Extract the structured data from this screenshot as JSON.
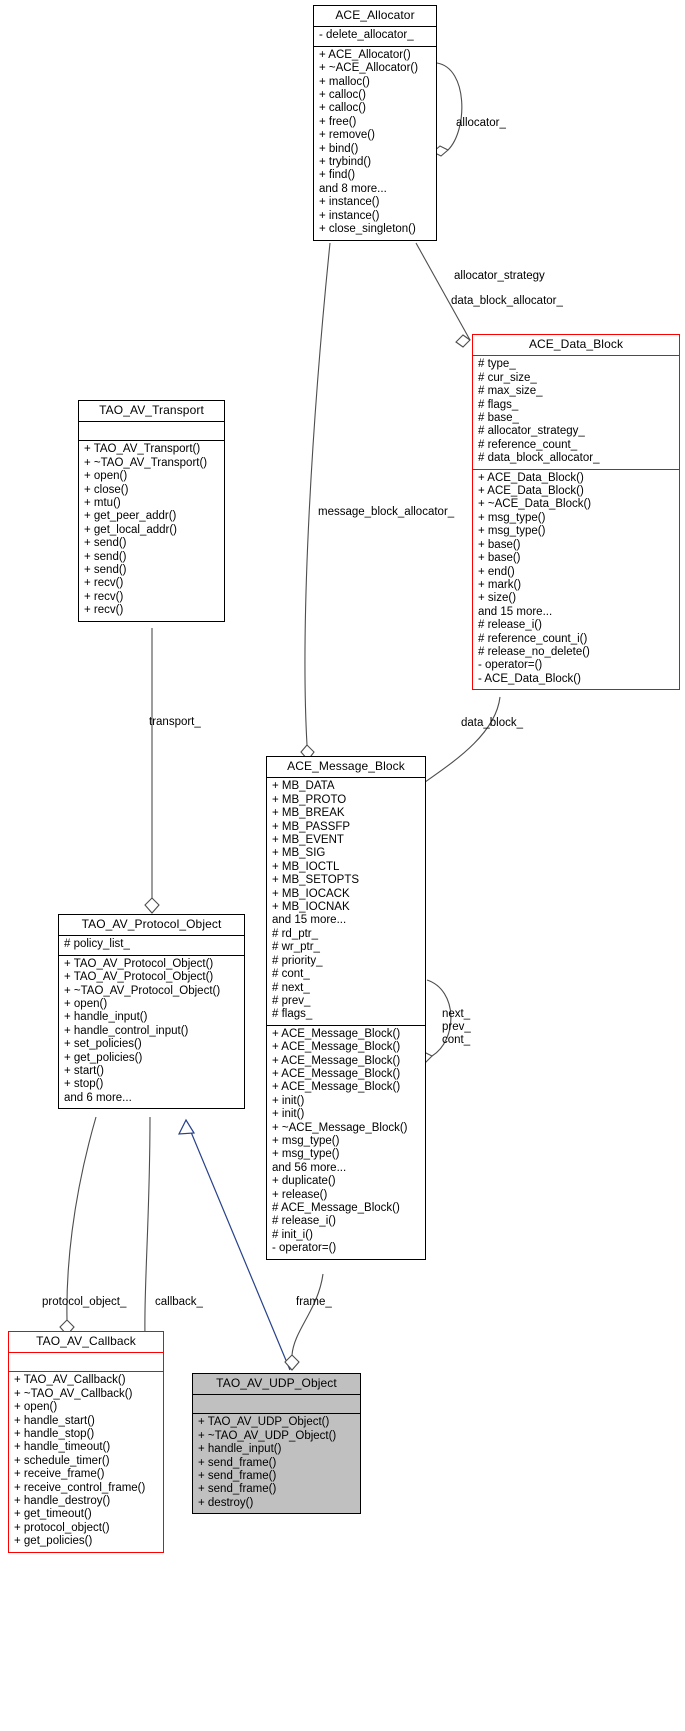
{
  "diagram": {
    "type": "uml-collaboration-diagram",
    "background": "#ffffff",
    "classes": [
      {
        "id": "ace_allocator",
        "title": "ACE_Allocator",
        "border_color": "#000000",
        "fill": "#ffffff",
        "attributes": [
          "- delete_allocator_"
        ],
        "operations": [
          "+ ACE_Allocator()",
          "+ ~ACE_Allocator()",
          "+ malloc()",
          "+ calloc()",
          "+ calloc()",
          "+ free()",
          "+ remove()",
          "+ bind()",
          "+ trybind()",
          "+ find()",
          "and 8 more...",
          "+ instance()",
          "+ instance()",
          "+ close_singleton()"
        ]
      },
      {
        "id": "ace_data_block",
        "title": "ACE_Data_Block",
        "border_color": "#ff0000",
        "fill": "#ffffff",
        "attributes": [
          "# type_",
          "# cur_size_",
          "# max_size_",
          "# flags_",
          "# base_",
          "# allocator_strategy_",
          "# reference_count_",
          "# data_block_allocator_"
        ],
        "operations": [
          "+ ACE_Data_Block()",
          "+ ACE_Data_Block()",
          "+ ~ACE_Data_Block()",
          "+ msg_type()",
          "+ msg_type()",
          "+ base()",
          "+ base()",
          "+ end()",
          "+ mark()",
          "+ size()",
          "and 15 more...",
          "# release_i()",
          "# reference_count_i()",
          "# release_no_delete()",
          "- operator=()",
          "- ACE_Data_Block()"
        ]
      },
      {
        "id": "tao_av_transport",
        "title": "TAO_AV_Transport",
        "border_color": "#000000",
        "fill": "#ffffff",
        "attributes": [],
        "operations": [
          "+ TAO_AV_Transport()",
          "+ ~TAO_AV_Transport()",
          "+ open()",
          "+ close()",
          "+ mtu()",
          "+ get_peer_addr()",
          "+ get_local_addr()",
          "+ send()",
          "+ send()",
          "+ send()",
          "+ recv()",
          "+ recv()",
          "+ recv()"
        ]
      },
      {
        "id": "ace_message_block",
        "title": "ACE_Message_Block",
        "border_color": "#000000",
        "fill": "#ffffff",
        "attributes": [
          "+ MB_DATA",
          "+ MB_PROTO",
          "+ MB_BREAK",
          "+ MB_PASSFP",
          "+ MB_EVENT",
          "+ MB_SIG",
          "+ MB_IOCTL",
          "+ MB_SETOPTS",
          "+ MB_IOCACK",
          "+ MB_IOCNAK",
          "and 15 more...",
          "# rd_ptr_",
          "# wr_ptr_",
          "# priority_",
          "# cont_",
          "# next_",
          "# prev_",
          "# flags_"
        ],
        "operations": [
          "+ ACE_Message_Block()",
          "+ ACE_Message_Block()",
          "+ ACE_Message_Block()",
          "+ ACE_Message_Block()",
          "+ ACE_Message_Block()",
          "+ init()",
          "+ init()",
          "+ ~ACE_Message_Block()",
          "+ msg_type()",
          "+ msg_type()",
          "and 56 more...",
          "+ duplicate()",
          "+ release()",
          "# ACE_Message_Block()",
          "# release_i()",
          "# init_i()",
          "- operator=()",
          "- ACE_Message_Block()"
        ]
      },
      {
        "id": "tao_av_protocol_object",
        "title": "TAO_AV_Protocol_Object",
        "border_color": "#000000",
        "fill": "#ffffff",
        "attributes": [
          "# policy_list_"
        ],
        "operations": [
          "+ TAO_AV_Protocol_Object()",
          "+ TAO_AV_Protocol_Object()",
          "+ ~TAO_AV_Protocol_Object()",
          "+ open()",
          "+ handle_input()",
          "+ handle_control_input()",
          "+ set_policies()",
          "+ get_policies()",
          "+ start()",
          "+ stop()",
          "and 6 more..."
        ]
      },
      {
        "id": "tao_av_callback",
        "title": "TAO_AV_Callback",
        "border_color": "#ff0000",
        "fill": "#ffffff",
        "attributes": [],
        "operations": [
          "+ TAO_AV_Callback()",
          "+ ~TAO_AV_Callback()",
          "+ open()",
          "+ handle_start()",
          "+ handle_stop()",
          "+ handle_timeout()",
          "+ schedule_timer()",
          "+ receive_frame()",
          "+ receive_control_frame()",
          "+ handle_destroy()",
          "+ get_timeout()",
          "+ protocol_object()",
          "+ get_policies()"
        ]
      },
      {
        "id": "tao_av_udp_object",
        "title": "TAO_AV_UDP_Object",
        "border_color": "#000000",
        "fill": "#c0c0c0",
        "attributes": [],
        "operations": [
          "+ TAO_AV_UDP_Object()",
          "+ ~TAO_AV_UDP_Object()",
          "+ handle_input()",
          "+ send_frame()",
          "+ send_frame()",
          "+ send_frame()",
          "+ destroy()"
        ]
      }
    ],
    "edge_labels": [
      {
        "id": "allocator",
        "text": "allocator_"
      },
      {
        "id": "allocator_strategy",
        "text": "allocator_strategy"
      },
      {
        "id": "data_block_allocator",
        "text": "data_block_allocator_"
      },
      {
        "id": "message_block_allocator",
        "text": "message_block_allocator_"
      },
      {
        "id": "data_block",
        "text": "data_block_"
      },
      {
        "id": "transport",
        "text": "transport_"
      },
      {
        "id": "next_prev_cont_line1",
        "text": "next_"
      },
      {
        "id": "next_prev_cont_line2",
        "text": "prev_"
      },
      {
        "id": "next_prev_cont_line3",
        "text": "cont_"
      },
      {
        "id": "protocol_object",
        "text": "protocol_object_"
      },
      {
        "id": "callback",
        "text": "callback_"
      },
      {
        "id": "frame",
        "text": "frame_"
      }
    ]
  }
}
